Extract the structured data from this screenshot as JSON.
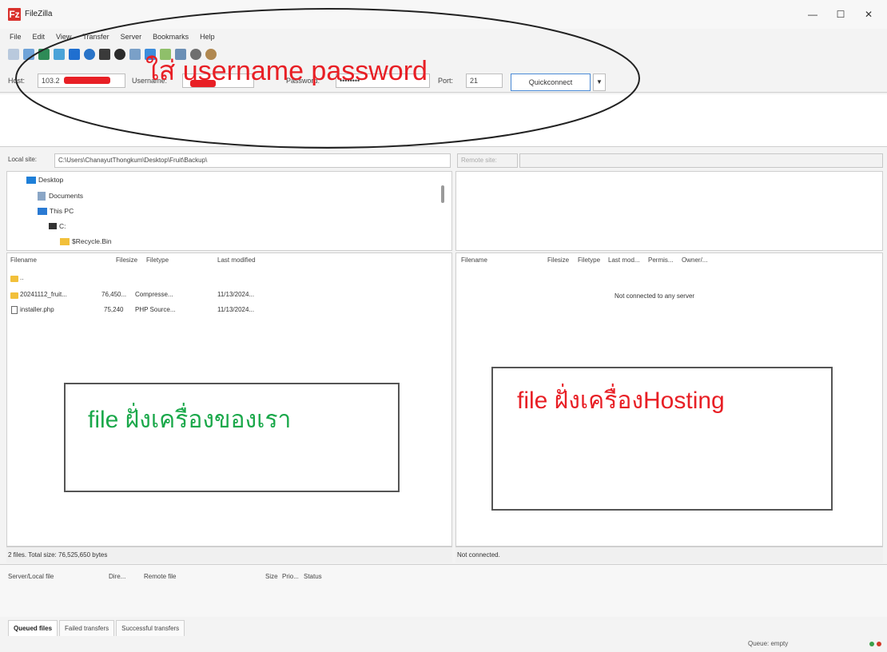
{
  "window": {
    "title": "FileZilla",
    "logo": "Fz",
    "minimize": "—",
    "maximize": "☐",
    "close": "✕"
  },
  "menu": [
    "File",
    "Edit",
    "View",
    "Transfer",
    "Server",
    "Bookmarks",
    "Help"
  ],
  "quickconnect": {
    "host_label": "Host:",
    "host_value": "103.2",
    "username_label": "Username:",
    "password_label": "Password:",
    "password_value": "••••••••",
    "port_label": "Port:",
    "port_value": "21",
    "button_label": "Quickconnect",
    "dropdown_arrow": "▼"
  },
  "local": {
    "site_label": "Local site:",
    "site_path": "C:\\Users\\ChanayutThongkum\\Desktop\\Fruit\\Backup\\",
    "tree": [
      {
        "label": "Desktop"
      },
      {
        "label": "Documents"
      },
      {
        "label": "This PC"
      },
      {
        "label": "C:"
      },
      {
        "label": "$Recycle.Bin"
      }
    ],
    "columns": [
      "Filename",
      "Filesize",
      "Filetype",
      "Last modified"
    ],
    "files": [
      {
        "name": "..",
        "size": "",
        "type": "",
        "modified": ""
      },
      {
        "name": "20241112_fruit...",
        "size": "76,450...",
        "type": "Compresse...",
        "modified": "11/13/2024..."
      },
      {
        "name": "installer.php",
        "size": "75,240",
        "type": "PHP Source...",
        "modified": "11/13/2024..."
      }
    ],
    "status": "2 files. Total size: 76,525,650 bytes"
  },
  "remote": {
    "site_label": "Remote site:",
    "columns": [
      "Filename",
      "Filesize",
      "Filetype",
      "Last mod...",
      "Permis...",
      "Owner/..."
    ],
    "empty_message": "Not connected to any server",
    "status": "Not connected."
  },
  "queue": {
    "columns": [
      "Server/Local file",
      "Dire...",
      "Remote file",
      "Size",
      "Prio...",
      "Status"
    ],
    "tabs": [
      "Queued files",
      "Failed transfers",
      "Successful transfers"
    ],
    "status": "Queue: empty"
  },
  "annotations": {
    "credentials": "ใส่ username password",
    "local": "file ฝั่งเครื่องของเรา",
    "remote": "file ฝั่งเครื่องHosting",
    "credentials_color": "#e81f25",
    "local_color": "#1aa84a",
    "remote_color": "#e81f25"
  }
}
